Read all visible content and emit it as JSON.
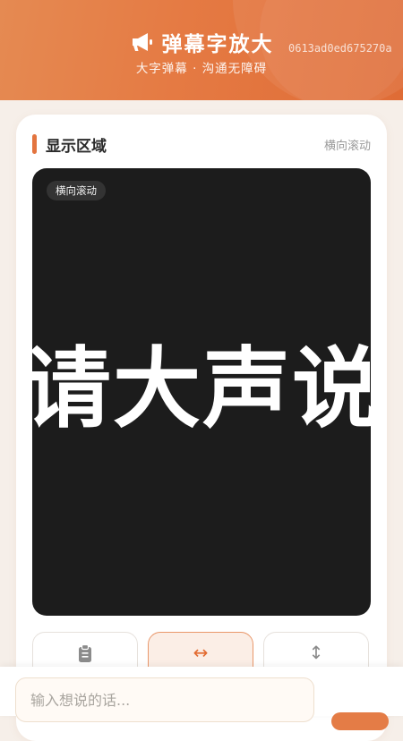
{
  "header": {
    "title": "弹幕字放大",
    "subtitle": "大字弹幕 · 沟通无障碍",
    "hash": "0613ad0ed675270a"
  },
  "section": {
    "title": "显示区域",
    "mode_label": "横向滚动"
  },
  "display": {
    "badge": "横向滚动",
    "text": "请大声说出"
  },
  "modes": [
    {
      "name": "paste",
      "icon": "clipboard-icon"
    },
    {
      "name": "horizontal",
      "icon": "horizontal-arrows-icon",
      "active": true
    },
    {
      "name": "vertical",
      "icon": "vertical-arrows-icon"
    }
  ],
  "input": {
    "placeholder": "输入想说的话...",
    "value": ""
  },
  "colors": {
    "accent": "#e3743f",
    "display_bg": "#1c1c1c"
  }
}
